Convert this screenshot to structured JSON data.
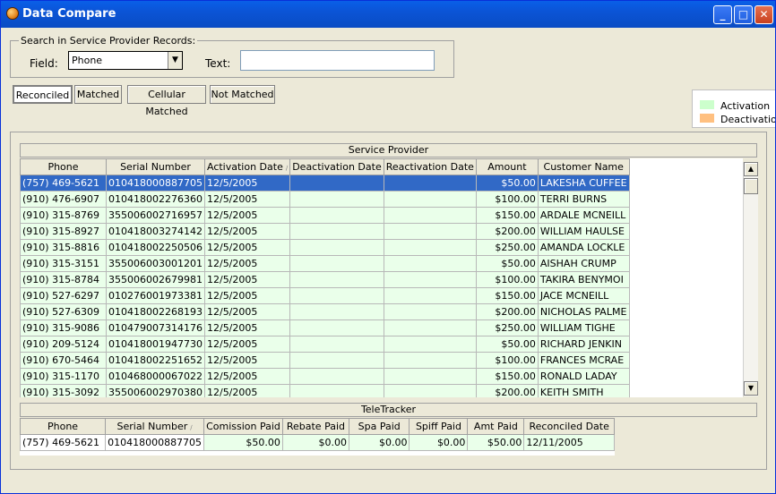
{
  "window": {
    "title": "Data Compare"
  },
  "search": {
    "group_label": "Search in Service Provider Records:",
    "field_label": "Field:",
    "field_value": "Phone",
    "text_label": "Text:",
    "text_value": ""
  },
  "tabs": [
    {
      "label": "Reconciled",
      "active": true
    },
    {
      "label": "Matched",
      "active": false
    },
    {
      "label": "Cellular Matched",
      "active": false
    },
    {
      "label": "Not Matched",
      "active": false
    }
  ],
  "legend": {
    "activation": {
      "label": "Activation",
      "color": "#ccffcc"
    },
    "deactivation": {
      "label": "Deactivation",
      "color": "#ffc080"
    }
  },
  "service_provider": {
    "title": "Service Provider",
    "columns": [
      "Phone",
      "Serial Number",
      "Activation Date",
      "Deactivation Date",
      "Reactivation Date",
      "Amount",
      "Customer Name"
    ],
    "rows": [
      [
        "(757) 469-5621",
        "010418000887705",
        "12/5/2005",
        "",
        "",
        "$50.00",
        "LAKESHA CUFFEE"
      ],
      [
        "(910) 476-6907",
        "010418002276360",
        "12/5/2005",
        "",
        "",
        "$100.00",
        "TERRI BURNS"
      ],
      [
        "(910) 315-8769",
        "355006002716957",
        "12/5/2005",
        "",
        "",
        "$150.00",
        "ARDALE MCNEILL"
      ],
      [
        "(910) 315-8927",
        "010418003274142",
        "12/5/2005",
        "",
        "",
        "$200.00",
        "WILLIAM HAULSE"
      ],
      [
        "(910) 315-8816",
        "010418002250506",
        "12/5/2005",
        "",
        "",
        "$250.00",
        "AMANDA LOCKLE"
      ],
      [
        "(910) 315-3151",
        "355006003001201",
        "12/5/2005",
        "",
        "",
        "$50.00",
        "AISHAH CRUMP"
      ],
      [
        "(910) 315-8784",
        "355006002679981",
        "12/5/2005",
        "",
        "",
        "$100.00",
        "TAKIRA BENYMOI"
      ],
      [
        "(910) 527-6297",
        "010276001973381",
        "12/5/2005",
        "",
        "",
        "$150.00",
        "JACE MCNEILL"
      ],
      [
        "(910) 527-6309",
        "010418002268193",
        "12/5/2005",
        "",
        "",
        "$200.00",
        "NICHOLAS PALME"
      ],
      [
        "(910) 315-9086",
        "010479007314176",
        "12/5/2005",
        "",
        "",
        "$250.00",
        "WILLIAM TIGHE"
      ],
      [
        "(910) 209-5124",
        "010418001947730",
        "12/5/2005",
        "",
        "",
        "$50.00",
        "RICHARD JENKIN"
      ],
      [
        "(910) 670-5464",
        "010418002251652",
        "12/5/2005",
        "",
        "",
        "$100.00",
        "FRANCES MCRAE"
      ],
      [
        "(910) 315-1170",
        "010468000067022",
        "12/5/2005",
        "",
        "",
        "$150.00",
        "RONALD LADAY"
      ],
      [
        "(910) 315-3092",
        "355006002970380",
        "12/5/2005",
        "",
        "",
        "$200.00",
        "KEITH SMITH"
      ]
    ]
  },
  "teletracker": {
    "title": "TeleTracker",
    "columns": [
      "Phone",
      "Serial Number",
      "Comission Paid",
      "Rebate Paid",
      "Spa Paid",
      "Spiff Paid",
      "Amt Paid",
      "Reconciled Date"
    ],
    "rows": [
      [
        "(757) 469-5621",
        "010418000887705",
        "$50.00",
        "$0.00",
        "$0.00",
        "$0.00",
        "$50.00",
        "12/11/2005"
      ]
    ]
  },
  "icons": {
    "app": "app-ball-icon",
    "minimize": "minimize-icon",
    "maximize": "maximize-icon",
    "close": "close-icon",
    "dropdown": "chevron-down-icon",
    "sort": "sort-asc-icon",
    "scroll_up": "scroll-up-icon",
    "scroll_down": "scroll-down-icon"
  }
}
